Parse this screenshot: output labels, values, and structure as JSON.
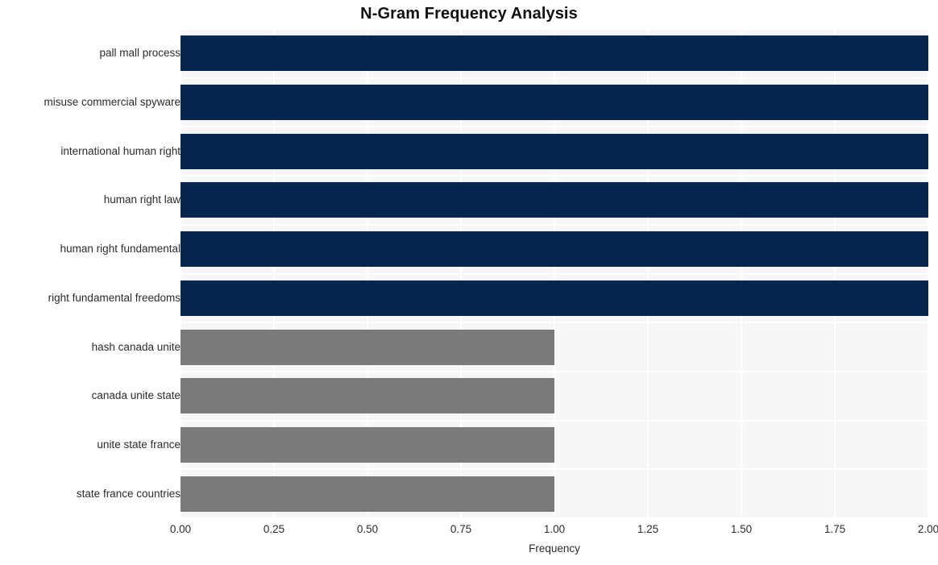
{
  "chart_data": {
    "type": "bar",
    "orientation": "horizontal",
    "title": "N-Gram Frequency Analysis",
    "xlabel": "Frequency",
    "ylabel": "",
    "categories": [
      "pall mall process",
      "misuse commercial spyware",
      "international human right",
      "human right law",
      "human right fundamental",
      "right fundamental freedoms",
      "hash canada unite",
      "canada unite state",
      "unite state france",
      "state france countries"
    ],
    "values": [
      2,
      2,
      2,
      2,
      2,
      2,
      1,
      1,
      1,
      1
    ],
    "bar_colors": [
      "#062650",
      "#062650",
      "#062650",
      "#062650",
      "#062650",
      "#062650",
      "#7c7b79",
      "#7c7b79",
      "#7c7b79",
      "#7c7b79"
    ],
    "xlim": [
      0,
      2.0
    ],
    "xticks": [
      0,
      0.25,
      0.5,
      0.75,
      1.0,
      1.25,
      1.5,
      1.75,
      2.0
    ],
    "xtick_labels": [
      "0.00",
      "0.25",
      "0.50",
      "0.75",
      "1.00",
      "1.25",
      "1.50",
      "1.75",
      "2.00"
    ],
    "grid": true,
    "grid_color": "#ffffff",
    "plot_background": "#f6f6f7",
    "figure_background": "#ffffff",
    "legend": null
  }
}
